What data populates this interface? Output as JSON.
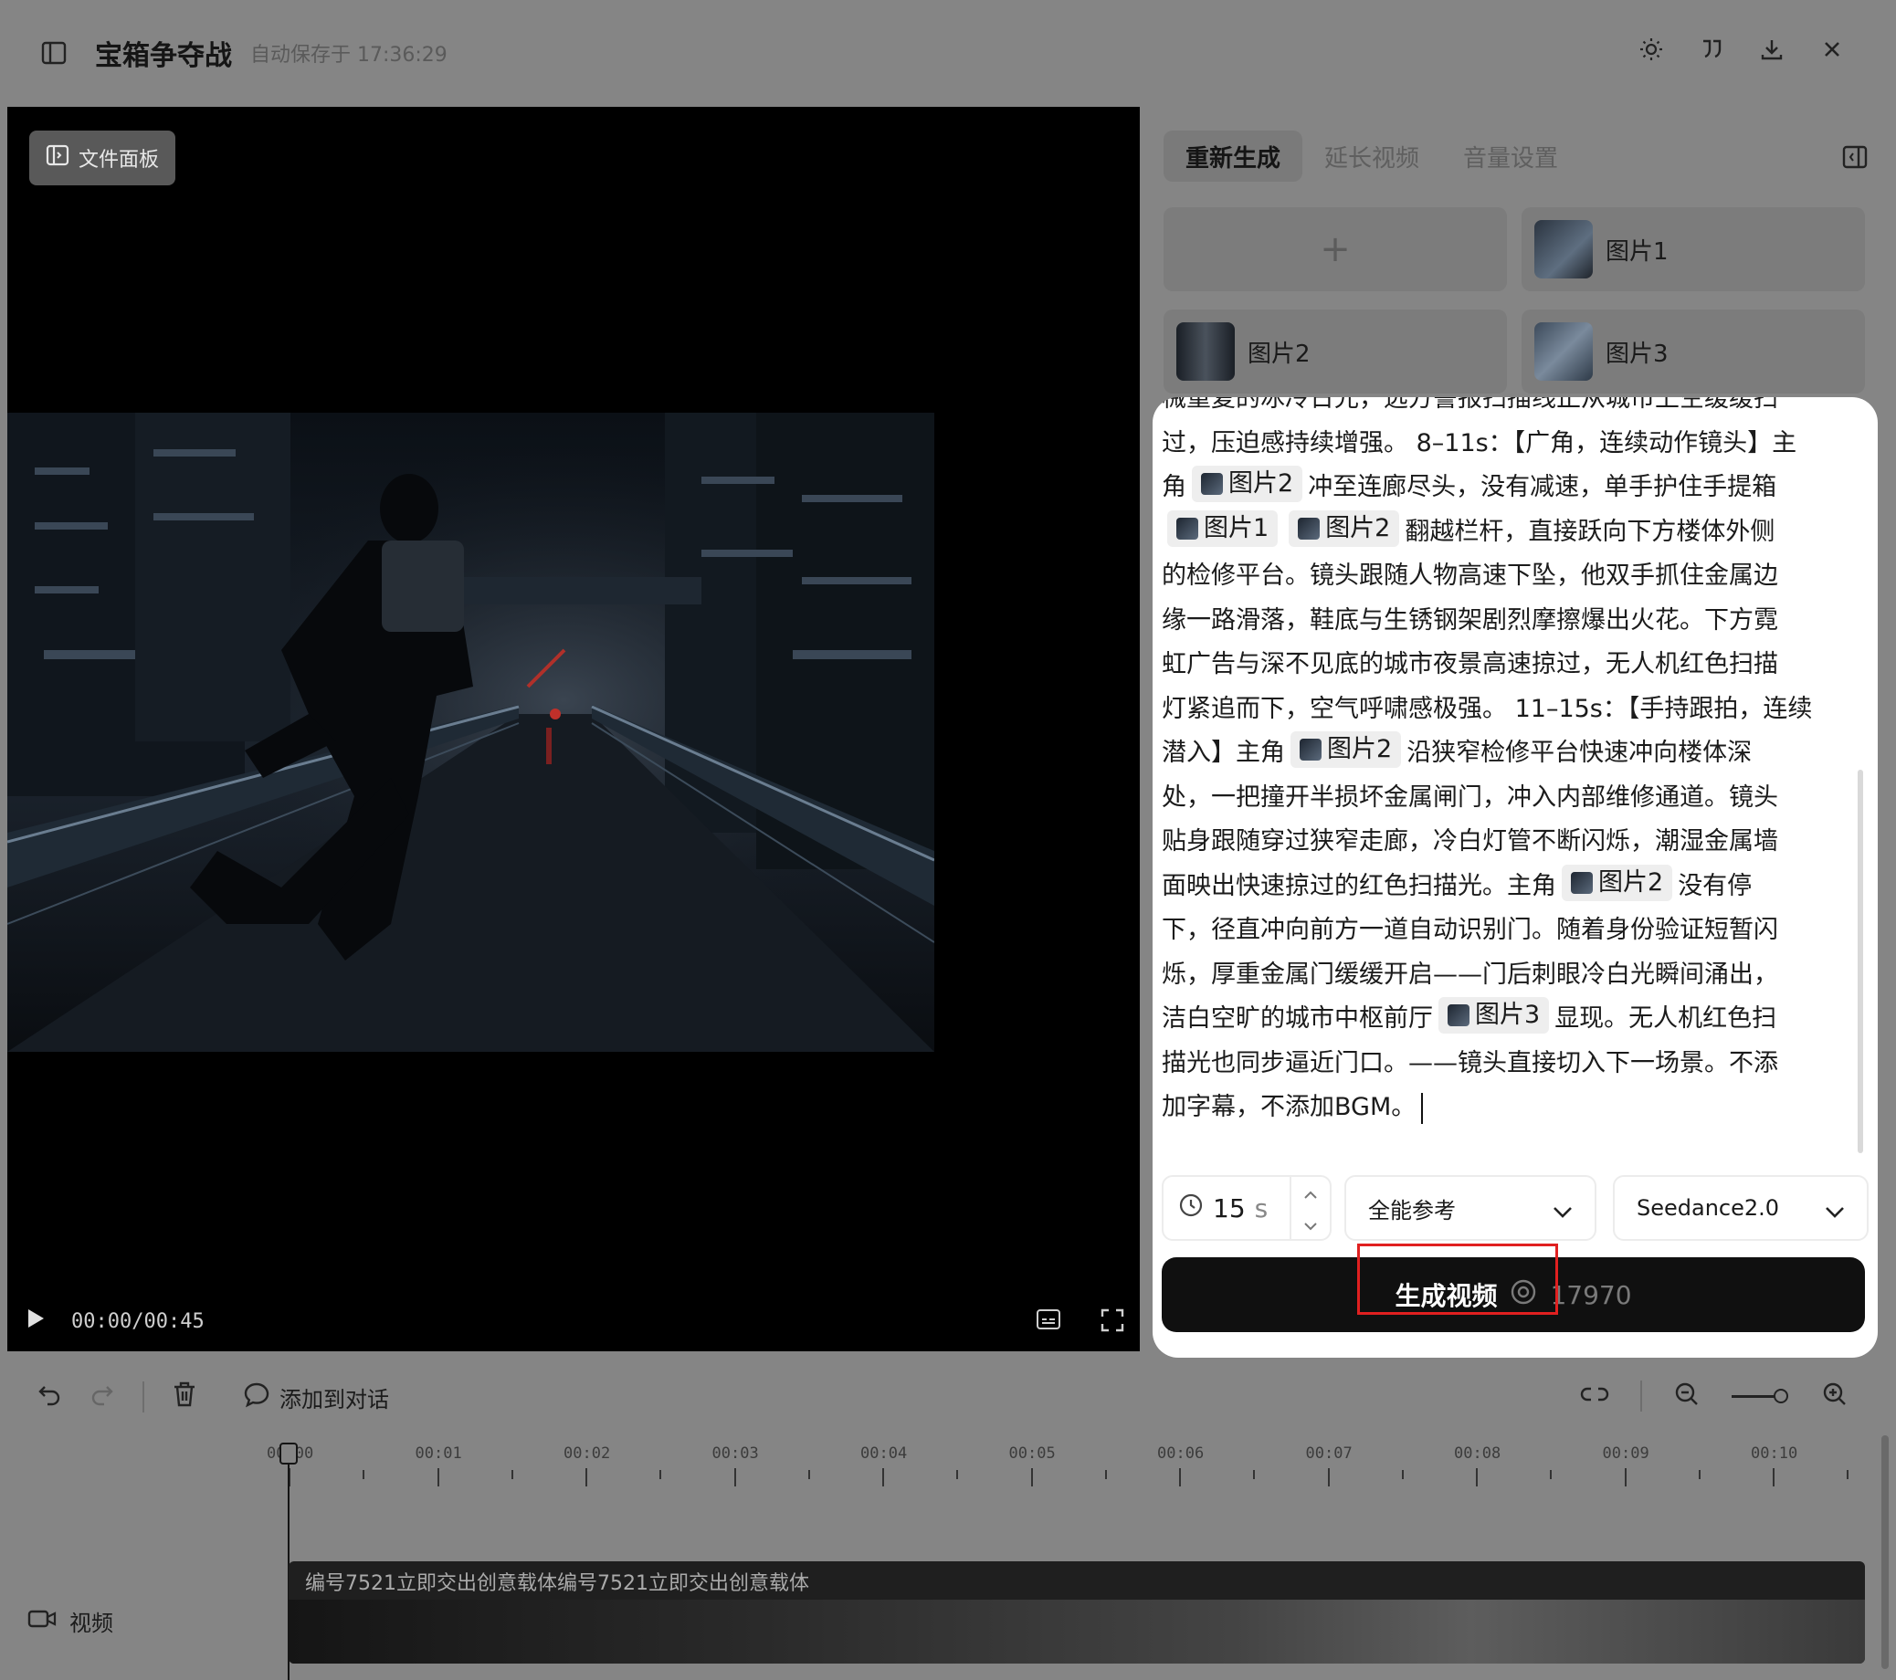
{
  "header": {
    "title": "宝箱争夺战",
    "saved_text": "自动保存于 17:36:29"
  },
  "player": {
    "file_panel_label": "文件面板",
    "time": "00:00/00:45"
  },
  "right_panel": {
    "tabs": [
      {
        "label": "重新生成",
        "active": true
      },
      {
        "label": "延长视频",
        "active": false
      },
      {
        "label": "音量设置",
        "active": false
      }
    ],
    "add_symbol": "+",
    "images": [
      {
        "label": "图片1"
      },
      {
        "label": "图片2"
      },
      {
        "label": "图片3"
      }
    ]
  },
  "editor": {
    "lines": [
      [
        "械重复的冰冷日光，远方警报扫描线正从城市上空缓缓扫"
      ],
      [
        "过，压迫感持续增强。 8–11s：【广角，连续动作镜头】主"
      ],
      [
        "角",
        {
          "tag": "图片2"
        },
        "冲至连廊尽头，没有减速，单手护住手提箱"
      ],
      [
        {
          "tag": "图片1"
        },
        {
          "tag": "图片2"
        },
        "翻越栏杆，直接跃向下方楼体外侧"
      ],
      [
        "的检修平台。镜头跟随人物高速下坠，他双手抓住金属边"
      ],
      [
        "缘一路滑落，鞋底与生锈钢架剧烈摩擦爆出火花。下方霓"
      ],
      [
        "虹广告与深不见底的城市夜景高速掠过，无人机红色扫描"
      ],
      [
        "灯紧追而下，空气呼啸感极强。 11–15s：【手持跟拍，连续"
      ],
      [
        "潜入】主角",
        {
          "tag": "图片2"
        },
        "沿狭窄检修平台快速冲向楼体深"
      ],
      [
        "处，一把撞开半损坏金属闸门，冲入内部维修通道。镜头"
      ],
      [
        "贴身跟随穿过狭窄走廊，冷白灯管不断闪烁，潮湿金属墙"
      ],
      [
        "面映出快速掠过的红色扫描光。主角",
        {
          "tag": "图片2"
        },
        "没有停"
      ],
      [
        "下，径直冲向前方一道自动识别门。随着身份验证短暂闪"
      ],
      [
        "烁，厚重金属门缓缓开启——门后刺眼冷白光瞬间涌出，"
      ],
      [
        "洁白空旷的城市中枢前厅",
        {
          "tag": "图片3"
        },
        "显现。无人机红色扫"
      ],
      [
        "描光也同步逼近门口。——镜头直接切入下一场景。不添"
      ],
      [
        "加字幕，不添加BGM。"
      ]
    ],
    "duration_value": "15",
    "duration_unit": "s",
    "reference_mode": "全能参考",
    "model": "Seedance2.0",
    "generate_label": "生成视频",
    "generate_cost": "17970"
  },
  "timeline": {
    "add_to_chat_label": "添加到对话",
    "ticks": [
      "00:00",
      "00:01",
      "00:02",
      "00:03",
      "00:04",
      "00:05",
      "00:06",
      "00:07",
      "00:08",
      "00:09",
      "00:10"
    ],
    "track_label": "视频",
    "clip_title": "编号7521立即交出创意载体编号7521立即交出创意载体"
  },
  "colors": {
    "highlight_box": "#e02020",
    "generate_button": "#101010"
  }
}
